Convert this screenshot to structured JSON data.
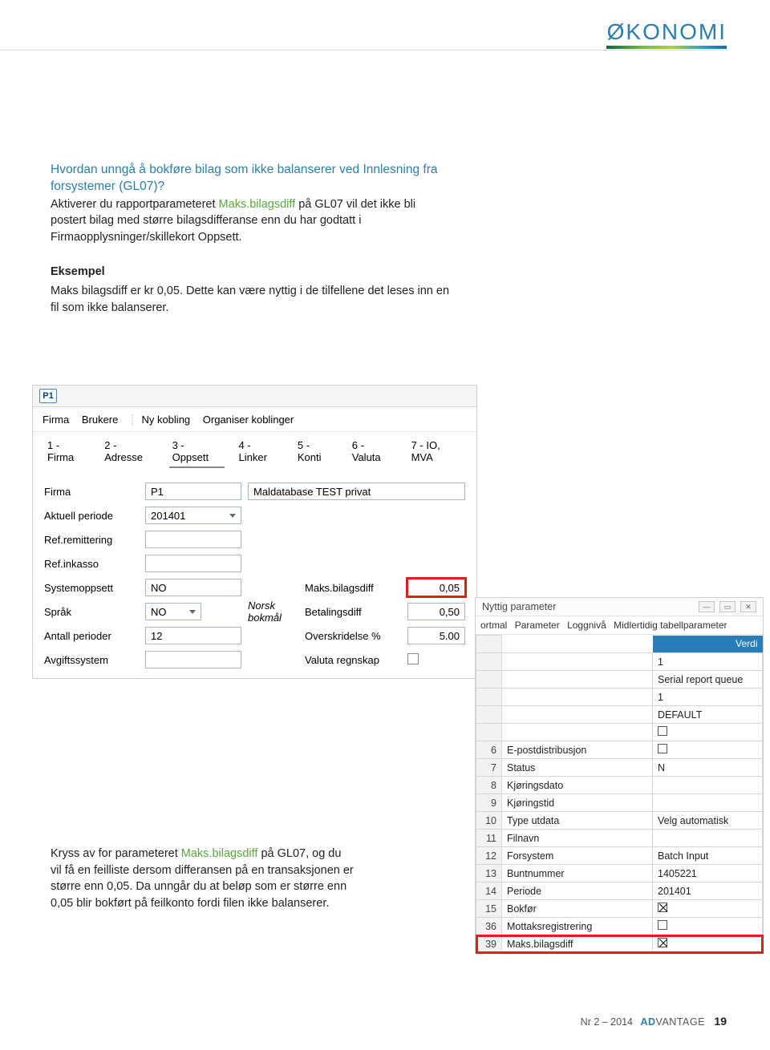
{
  "section_label": "ØKONOMI",
  "intro": "Hvordan unngå å bokføre bilag som ikke balanserer ved Innlesning fra forsystemer (GL07)?",
  "para1a": "Aktiverer du rapportparameteret ",
  "para1_green": "Maks.bilagsdiff",
  "para1b": " på GL07 vil det ikke bli postert bilag med større bilagsdifferanse enn du har godtatt i Firmaopplysninger/skillekort Oppsett.",
  "eks_head": "Eksempel",
  "eks_body": "Maks bilagsdiff er kr 0,05. Dette kan være nyttig i de tilfellene det leses inn en fil som ikke balanserer.",
  "c2a": "Kryss av for parameteret ",
  "c2_green": "Maks.bilagsdiff",
  "c2b": " på GL07, og du vil få en feilliste dersom differansen på en transaksjonen er større enn 0,05. Da unngår du at beløp som er større enn 0,05 blir bokført på feilkonto fordi filen ikke balanserer.",
  "ss1": {
    "icon": "P1",
    "menu": {
      "firma": "Firma",
      "brukere": "Brukere",
      "ny": "Ny kobling",
      "org": "Organiser koblinger"
    },
    "tabs": [
      "1 - Firma",
      "2 - Adresse",
      "3 - Oppsett",
      "4 - Linker",
      "5 - Konti",
      "6 - Valuta",
      "7 - IO, MVA"
    ],
    "rows": {
      "firma_lbl": "Firma",
      "firma_v1": "P1",
      "firma_v2": "Maldatabase TEST privat",
      "ap_lbl": "Aktuell periode",
      "ap_v": "201401",
      "refrem": "Ref.remittering",
      "refink": "Ref.inkasso",
      "sysopp_lbl": "Systemoppsett",
      "sysopp_v": "NO",
      "maksb_lbl": "Maks.bilagsdiff",
      "maksb_v": "0,05",
      "sprak_lbl": "Språk",
      "sprak_v": "NO",
      "sprak_t": "Norsk bokmål",
      "betd_lbl": "Betalingsdiff",
      "betd_v": "0,50",
      "antp_lbl": "Antall perioder",
      "antp_v": "12",
      "over_lbl": "Overskridelse %",
      "over_v": "5.00",
      "avg_lbl": "Avgiftssystem",
      "valr_lbl": "Valuta regnskap"
    }
  },
  "ss2": {
    "title": "Nyttig parameter",
    "tabs": [
      "ortmal",
      "Parameter",
      "Loggnivå",
      "Midlertidig tabellparameter"
    ],
    "verdi": "Verdi",
    "rows": [
      {
        "n": "",
        "name": "",
        "val": "1"
      },
      {
        "n": "",
        "name": "",
        "val": "Serial report queue"
      },
      {
        "n": "",
        "name": "",
        "val": "1"
      },
      {
        "n": "",
        "name": "",
        "val": "DEFAULT"
      },
      {
        "n": "",
        "name": "",
        "val": "",
        "box": true
      },
      {
        "n": "6",
        "name": "E-postdistribusjon",
        "val": "",
        "box": true
      },
      {
        "n": "7",
        "name": "Status",
        "val": "N"
      },
      {
        "n": "8",
        "name": "Kjøringsdato",
        "val": ""
      },
      {
        "n": "9",
        "name": "Kjøringstid",
        "val": ""
      },
      {
        "n": "10",
        "name": "Type utdata",
        "val": "Velg automatisk"
      },
      {
        "n": "11",
        "name": "Filnavn",
        "val": ""
      },
      {
        "n": "12",
        "name": "Forsystem",
        "val": "Batch Input"
      },
      {
        "n": "13",
        "name": "Buntnummer",
        "val": "1405221"
      },
      {
        "n": "14",
        "name": "Periode",
        "val": "201401"
      },
      {
        "n": "15",
        "name": "Bokfør",
        "val": "",
        "box": true,
        "checked": true
      },
      {
        "n": "36",
        "name": "Mottaksregistrering",
        "val": "",
        "box": true
      },
      {
        "n": "39",
        "name": "Maks.bilagsdiff",
        "val": "",
        "box": true,
        "checked": true,
        "hl": true
      }
    ]
  },
  "footer": {
    "issue": "Nr 2 – 2014",
    "brand_a": "AD",
    "brand_b": "VANTAGE",
    "page": "19"
  }
}
